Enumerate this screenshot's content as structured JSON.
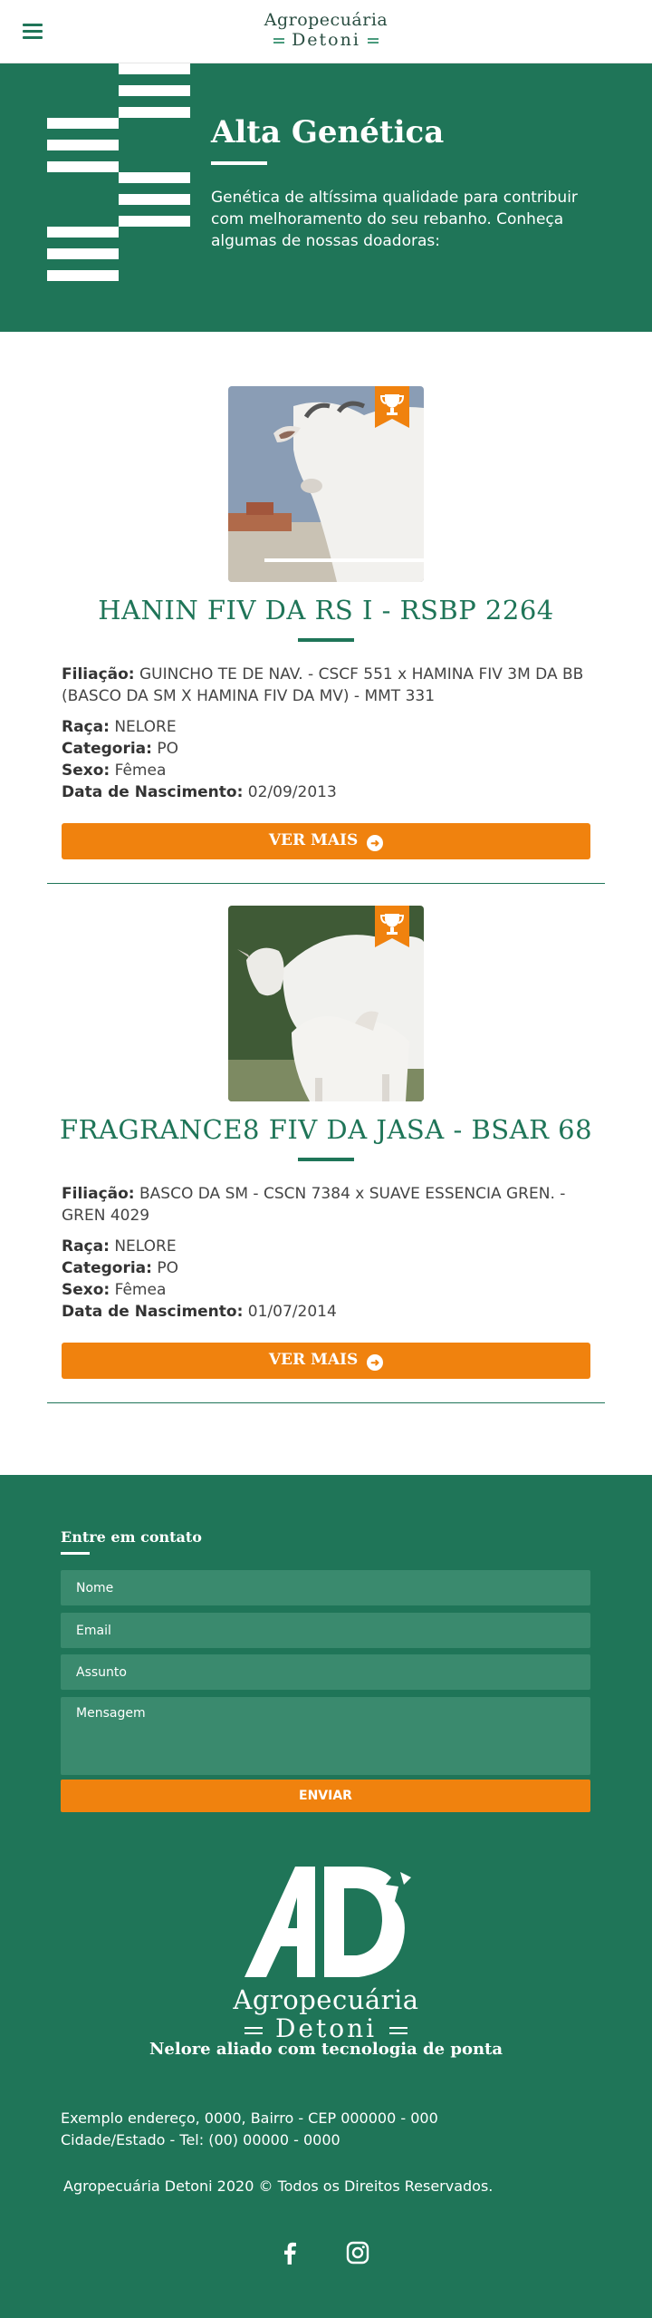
{
  "header": {
    "logo_line1": "Agropecuária",
    "logo_line2": "Detoni",
    "menu_icon": "hamburger-menu-icon"
  },
  "hero": {
    "title": "Alta Genética",
    "text": "Genética de altíssima qualidade para contribuir com melhoramento do seu rebanho. Conheça algumas de nossas doadoras:"
  },
  "labels": {
    "filiacao": "Filiação:",
    "raca": "Raça:",
    "categoria": "Categoria:",
    "sexo": "Sexo:",
    "nascimento": "Data de Nascimento:",
    "ver_mais": "VER MAIS"
  },
  "animals": [
    {
      "name": "HANIN FIV DA RS I - RSBP 2264",
      "filiacao": "GUINCHO TE DE NAV. - CSCF 551 x HAMINA FIV 3M DA BB (BASCO DA SM X HAMINA FIV DA MV) - MMT 331",
      "raca": "NELORE",
      "categoria": "PO",
      "sexo": "Fêmea",
      "nascimento": "02/09/2013",
      "badge_icon": "trophy-icon"
    },
    {
      "name": "FRAGRANCE8 FIV DA JASA - BSAR 68",
      "filiacao": "BASCO DA SM - CSCN 7384 x SUAVE ESSENCIA GREN. - GREN 4029",
      "raca": "NELORE",
      "categoria": "PO",
      "sexo": "Fêmea",
      "nascimento": "01/07/2014",
      "badge_icon": "trophy-icon"
    }
  ],
  "contact": {
    "title": "Entre em contato",
    "name_placeholder": "Nome",
    "email_placeholder": "Email",
    "subject_placeholder": "Assunto",
    "message_placeholder": "Mensagem",
    "send_label": "ENVIAR"
  },
  "footer": {
    "logo_line1": "Agropecuária",
    "logo_line2": "Detoni",
    "slogan": "Nelore aliado com tecnologia de ponta",
    "address_line1": "Exemplo endereço, 0000, Bairro - CEP 000000 - 000",
    "address_line2": "Cidade/Estado - Tel: (00) 00000 - 0000",
    "copyright": "Agropecuária Detoni 2020 © Todos os Direitos Reservados.",
    "social_icons": [
      "facebook-icon",
      "instagram-icon"
    ]
  },
  "colors": {
    "brand_green": "#1f7558",
    "accent_orange": "#f0820e",
    "field_green": "#3a8a6e"
  }
}
